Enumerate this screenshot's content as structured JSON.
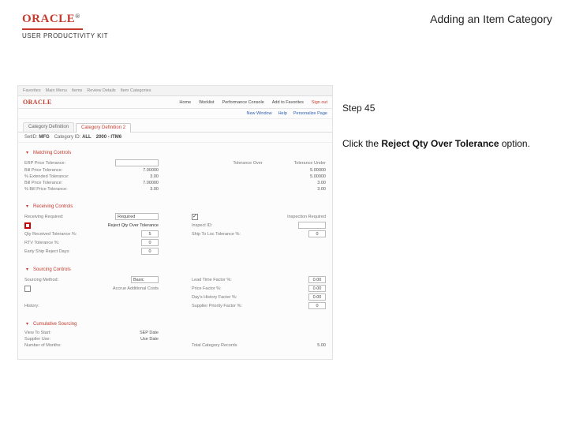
{
  "header": {
    "brand_main": "ORACLE",
    "brand_tm": "®",
    "brand_sub": "USER PRODUCTIVITY KIT",
    "page_title": "Adding an Item Category"
  },
  "instruction": {
    "step_label": "Step 45",
    "line1": "Click the ",
    "bold": "Reject Qty Over Tolerance",
    "line2": " option."
  },
  "shot": {
    "breadcrumb": [
      "Favorites",
      "Main Menu",
      "Items",
      "Review Details",
      "Item Categories"
    ],
    "toplinks": [
      "Home",
      "Worklist",
      "Performance Console",
      "Add to Favorites",
      "Sign out"
    ],
    "logo": "ORACLE",
    "nav": [
      "New Window",
      "Help",
      "Personalize Page"
    ],
    "tabs": [
      "Category Definition",
      "Category Definition 2"
    ],
    "setid_row": {
      "setid_l": "SetID:",
      "setid_v": "MFG",
      "cat_l": "Category ID:",
      "cat_v": "ALL",
      "desc_v": "2000 - ITM6"
    },
    "sec_matching": "Matching Controls",
    "matching": {
      "erp_l": "ERP Price Tolerance:",
      "erp_v": "",
      "bill_tol_l": "Bill Price Tolerance:",
      "bill_tol_v": "7.00000",
      "ext_tol_l": "% Extended Tolerance:",
      "ext_tol_v": "3.00",
      "bill_pct_l": "Bill Price Tolerance:",
      "bill_pct_v": "7.00000",
      "pct_ext_l": "% Bill Price Tolerance:",
      "pct_ext_v": "3.00",
      "tol_over_h": "Tolerance Over",
      "tol_under_h": "Tolerance Under",
      "tov_1": "5.00000",
      "tun_1": "5.00000",
      "tov_2": "3.00",
      "tun_2": "3.00"
    },
    "sec_receiving": "Receiving Controls",
    "recv": {
      "req_l": "Receiving Required:",
      "req_v": "Required",
      "insp_l": "Inspection Required",
      "insp_chk": true,
      "qty_l": "Qty Received Tolerance %:",
      "qty_v": "5",
      "reject_l": "Reject Qty Over Tolerance",
      "insp_id_l": "Inspect ID:",
      "rto_l": "RTV Tolerance %:",
      "rto_v": "0",
      "ship_to_l": "Ship To Loc Tolerance %:",
      "ship_to_v": "0",
      "early_l": "Early Ship Reject Days:",
      "early_v": "0"
    },
    "sec_sourcing": "Sourcing Controls",
    "src": {
      "method_l": "Sourcing Method:",
      "method_v": "Basic",
      "auto_l": "Accrue Additional Costs",
      "lead_l": "Lead Time Factor %:",
      "lead_v": "0.00",
      "price_l": "Price Factor %:",
      "price_v": "0.00",
      "hist_l": "History:",
      "day_l": "Day's History Factor %:",
      "day_v": "0.00",
      "sup_l": "Supplier Priority Factor %:",
      "sup_v": "0"
    },
    "sec_cum": "Cumulative Sourcing",
    "cum": {
      "start_l": "View To Start:",
      "start_v": "SEP Date",
      "sup_l": "Supplier Use:",
      "sup_v": "Use Date",
      "months_l": "Number of Months:",
      "tot_l": "Total Category Records",
      "tot_v": "5.00"
    }
  }
}
